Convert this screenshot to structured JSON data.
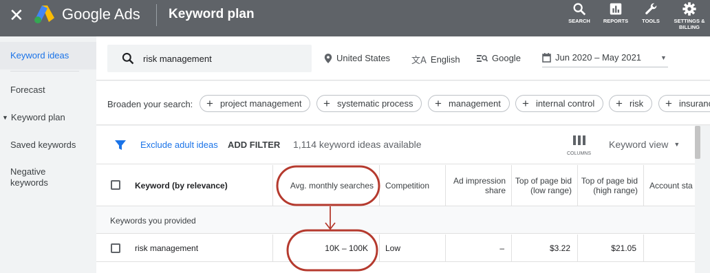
{
  "topbar": {
    "close": "✕",
    "brand": "Google Ads",
    "title": "Keyword plan",
    "tools": [
      {
        "label": "SEARCH",
        "icon": "search-icon"
      },
      {
        "label": "REPORTS",
        "icon": "reports-icon"
      },
      {
        "label": "TOOLS",
        "icon": "wrench-icon"
      },
      {
        "label1": "SETTINGS &",
        "label2": "BILLING",
        "icon": "gear-icon"
      }
    ]
  },
  "sidebar": {
    "items": [
      "Keyword ideas",
      "Forecast",
      "Keyword plan",
      "Saved keywords",
      "Negative keywords"
    ],
    "active": "Keyword ideas"
  },
  "search": {
    "value": "risk management",
    "location": "United States",
    "language": "English",
    "network": "Google",
    "date_range": "Jun 2020 – May 2021"
  },
  "broaden": {
    "label": "Broaden your search:",
    "chips": [
      "project management",
      "systematic process",
      "management",
      "internal control",
      "risk",
      "insuranc"
    ]
  },
  "filters": {
    "exclude": "Exclude adult ideas",
    "add": "ADD FILTER",
    "count": "1,114 keyword ideas available",
    "columns": "COLUMNS",
    "view": "Keyword view"
  },
  "table": {
    "headers": [
      "Keyword (by relevance)",
      "Avg. monthly searches",
      "Competition",
      "Ad impression share",
      "Top of page bid (low range)",
      "Top of page bid (high range)",
      "Account sta"
    ],
    "group": "Keywords you provided",
    "row": {
      "keyword": "risk management",
      "searches": "10K – 100K",
      "competition": "Low",
      "impression": "–",
      "bid_low": "$3.22",
      "bid_high": "$21.05"
    }
  },
  "colors": {
    "topbar": "#5f6368",
    "accent": "#1a73e8",
    "annotation": "#b53a2e"
  }
}
